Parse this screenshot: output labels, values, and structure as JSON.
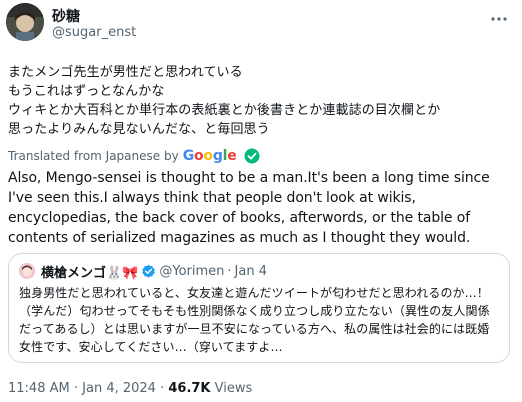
{
  "author": {
    "display_name": "砂糖",
    "handle": "@sugar_enst",
    "avatar_icon": "user-avatar"
  },
  "more_icon": "more-horizontal-icon",
  "tweet": {
    "text_ja": "またメンゴ先生が男性だと思われている\n もうこれはずっとなんかな\nウィキとか大百科とか単行本の表紙裏とか後書きとか連載誌の目次欄とか\n思ったよりみんな見ないんだな、と毎回思う",
    "translated_label": "Translated from Japanese by",
    "google": [
      "G",
      "o",
      "o",
      "g",
      "l",
      "e"
    ],
    "google_colors": [
      "#4285f4",
      "#ea4335",
      "#fbbc05",
      "#4285f4",
      "#34a853",
      "#ea4335"
    ],
    "translated_check_color": "#00ba7c",
    "text_en": "Also, Mengo-sensei is thought to be a man.It's been a long time since I've seen this.I always think that people don't look at wikis, encyclopedias, the back cover of books, afterwords, or the table of contents of serialized magazines as much as I thought they would."
  },
  "quote": {
    "display_name": "横槍メンゴ🐰🎀",
    "verified_color": "#1d9bf0",
    "handle": "@Yorimen",
    "separator": "·",
    "date": "Jan 4",
    "text": "独身男性だと思われていると、女友達と遊んだツイートが匂わせだと思われるのか…！（学んだ）匂わせってそもそも性別関係なく成り立つし成り立たない（異性の友人関係だってあるし）とは思いますが一旦不安になっている方へ、私の属性は社会的には既婚女性です、安心してください…（穿いてますよ…"
  },
  "meta": {
    "time": "11:48 AM",
    "separator": "·",
    "date": "Jan 4, 2024",
    "separator2": "·",
    "views_count": "46.7K",
    "views_label": "Views"
  }
}
